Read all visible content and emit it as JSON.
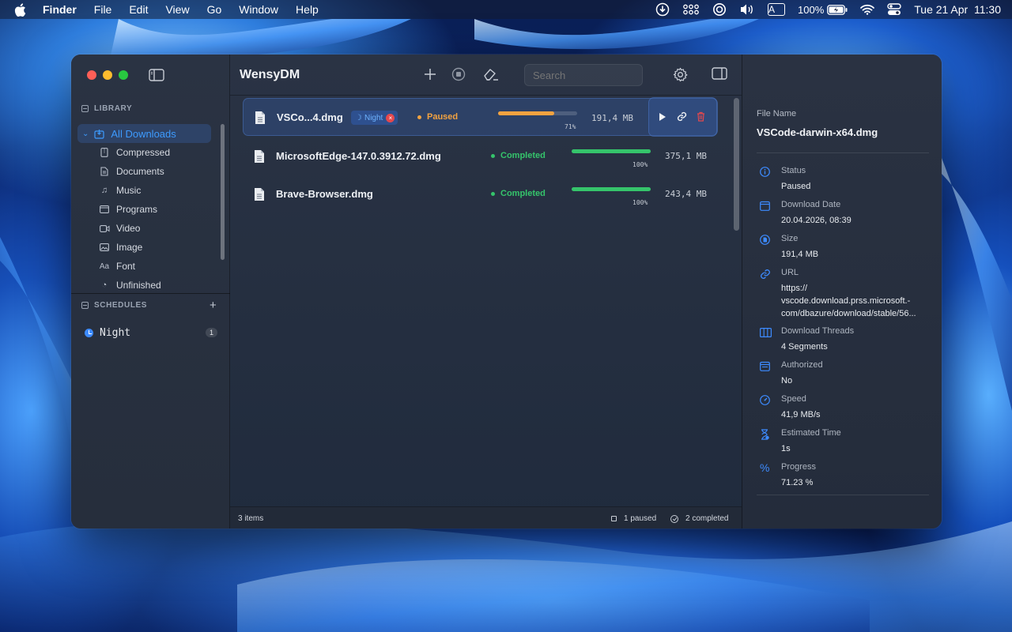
{
  "menubar": {
    "app_name": "Finder",
    "menus": [
      "File",
      "Edit",
      "View",
      "Go",
      "Window",
      "Help"
    ],
    "input_source": "A",
    "battery": "100%",
    "clock": "Tue 21 Apr  11:30"
  },
  "window": {
    "title": "WensyDM",
    "search_placeholder": "Search"
  },
  "sidebar": {
    "library_heading": "LIBRARY",
    "items": [
      {
        "label": "All Downloads",
        "icon": "downloads-icon"
      },
      {
        "label": "Compressed",
        "icon": "archive-icon"
      },
      {
        "label": "Documents",
        "icon": "document-icon"
      },
      {
        "label": "Music",
        "icon": "music-note-icon"
      },
      {
        "label": "Programs",
        "icon": "window-icon"
      },
      {
        "label": "Video",
        "icon": "video-camera-icon"
      },
      {
        "label": "Image",
        "icon": "photo-icon"
      },
      {
        "label": "Font",
        "icon": "font-icon"
      },
      {
        "label": "Unfinished",
        "icon": "clock-icon"
      }
    ],
    "schedules_heading": "SCHEDULES",
    "schedules": [
      {
        "label": "Night",
        "count": "1"
      }
    ]
  },
  "downloads": [
    {
      "name": "VSCo...4.dmg",
      "tag": "Night",
      "status": "Paused",
      "progress": 0.71,
      "percent_label": "71%",
      "size": "191,4 MB"
    },
    {
      "name": "MicrosoftEdge-147.0.3912.72.dmg",
      "status": "Completed",
      "progress": 1.0,
      "percent_label": "100%",
      "size": "375,1 MB"
    },
    {
      "name": "Brave-Browser.dmg",
      "status": "Completed",
      "progress": 1.0,
      "percent_label": "100%",
      "size": "243,4 MB"
    }
  ],
  "footer": {
    "items_count": "3 items",
    "paused": "1 paused",
    "completed": "2 completed"
  },
  "inspector": {
    "file_name_label": "File Name",
    "file_name": "VSCode-darwin-x64.dmg",
    "properties": [
      {
        "label": "Status",
        "value": "Paused",
        "icon": "info-icon"
      },
      {
        "label": "Download Date",
        "value": "20.04.2026, 08:39",
        "icon": "calendar-icon"
      },
      {
        "label": "Size",
        "value": "191,4 MB",
        "icon": "file-size-icon"
      },
      {
        "label": "URL",
        "icon": "link-icon",
        "value_lines": [
          "https://",
          "vscode.download.prss.microsoft.-",
          "com/dbazure/download/stable/56..."
        ]
      },
      {
        "label": "Download Threads",
        "value": "4 Segments",
        "icon": "columns-icon"
      },
      {
        "label": "Authorized",
        "value": "No",
        "icon": "id-card-icon"
      },
      {
        "label": "Speed",
        "value": "41,9 MB/s",
        "icon": "speedometer-icon"
      },
      {
        "label": "Estimated Time",
        "value": "1s",
        "icon": "hourglass-icon"
      },
      {
        "label": "Progress",
        "value": "71.23 %",
        "icon": "percent-icon"
      }
    ]
  },
  "colors": {
    "accent": "#3d9bff",
    "paused": "#f4a340",
    "completed": "#35c46b",
    "delete": "#e5484d"
  }
}
